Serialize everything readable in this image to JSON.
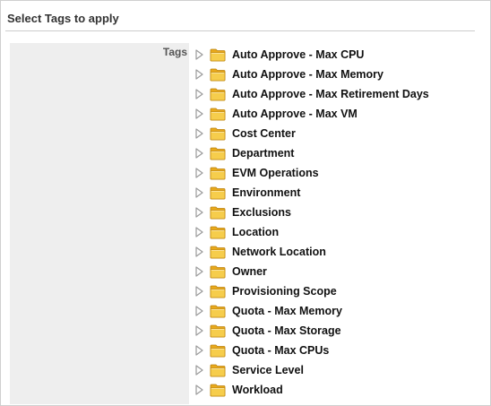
{
  "panel": {
    "title": "Select Tags to apply"
  },
  "form": {
    "tags_label": "Tags"
  },
  "tree": {
    "expander_icon": "triangle-right-icon",
    "folder_icon": "folder-icon",
    "folder_color": "#f4c430",
    "items": [
      {
        "label": "Auto Approve - Max CPU"
      },
      {
        "label": "Auto Approve - Max Memory"
      },
      {
        "label": "Auto Approve - Max Retirement Days"
      },
      {
        "label": "Auto Approve - Max VM"
      },
      {
        "label": "Cost Center"
      },
      {
        "label": "Department"
      },
      {
        "label": "EVM Operations"
      },
      {
        "label": "Environment"
      },
      {
        "label": "Exclusions"
      },
      {
        "label": "Location"
      },
      {
        "label": "Network Location"
      },
      {
        "label": "Owner"
      },
      {
        "label": "Provisioning Scope"
      },
      {
        "label": "Quota - Max Memory"
      },
      {
        "label": "Quota - Max Storage"
      },
      {
        "label": "Quota - Max CPUs"
      },
      {
        "label": "Service Level"
      },
      {
        "label": "Workload"
      }
    ]
  }
}
